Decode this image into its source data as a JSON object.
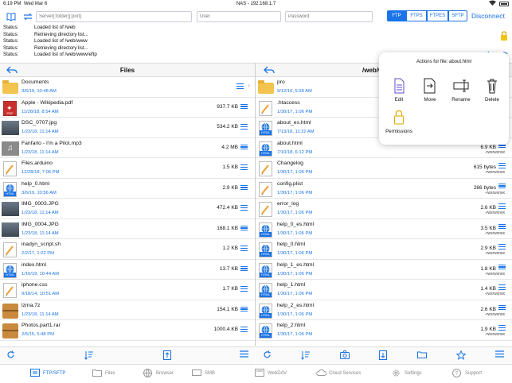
{
  "statusbar": {
    "time": "6:19 PM",
    "date": "Wed Mar 6",
    "title": "NAS - 192.168.1.7"
  },
  "connection": {
    "server_placeholder": "Server[:folder][:port]",
    "user_placeholder": "User",
    "password_placeholder": "Password",
    "protocols": [
      "FTP",
      "FTPS",
      "FTPES",
      "SFTP"
    ],
    "active_protocol": "FTP",
    "disconnect_label": "Disconnect"
  },
  "log": [
    {
      "k": "Status:",
      "v": "Loaded list of /web"
    },
    {
      "k": "Status:",
      "v": "Retrieving directory list..."
    },
    {
      "k": "Status:",
      "v": "Loaded list of /web/www"
    },
    {
      "k": "Status:",
      "v": "Retrieving directory list..."
    },
    {
      "k": "Status:",
      "v": "Loaded list of /web/www/eftp"
    }
  ],
  "left_pane": {
    "title": "Files",
    "rows": [
      {
        "name": "Documents",
        "date": "3/6/19, 10:48 AM",
        "size": "",
        "type": "folder"
      },
      {
        "name": "Apple - Wikipedia.pdf",
        "date": "11/28/18, 8:54 AM",
        "size": "937.7 KB",
        "type": "pdf"
      },
      {
        "name": "DSC_0707.jpg",
        "date": "1/23/18, 11:14 AM",
        "size": "534.2 KB",
        "type": "photo"
      },
      {
        "name": "Fanfarlo - I'm a Pilot.mp3",
        "date": "1/23/18, 11:14 AM",
        "size": "4.2 MB",
        "type": "audio"
      },
      {
        "name": "Files.arduino",
        "date": "12/28/18, 7:06 PM",
        "size": "1.5 KB",
        "type": "text"
      },
      {
        "name": "help_0.html",
        "date": "3/6/19, 10:56 AM",
        "size": "2.9 KB",
        "type": "html"
      },
      {
        "name": "IMG_0003.JPG",
        "date": "1/23/18, 11:14 AM",
        "size": "472.4 KB",
        "type": "photo"
      },
      {
        "name": "IMG_0004.JPG",
        "date": "1/23/18, 11:14 AM",
        "size": "168.1 KB",
        "type": "photo"
      },
      {
        "name": "inadyn_script.sh",
        "date": "2/2/17, 1:22 PM",
        "size": "1.2 KB",
        "type": "text"
      },
      {
        "name": "index.html",
        "date": "1/10/19, 10:44 AM",
        "size": "13.7 KB",
        "type": "html"
      },
      {
        "name": "iphone.css",
        "date": "9/18/14, 10:51 AM",
        "size": "1.7 KB",
        "type": "text"
      },
      {
        "name": "lzma.7z",
        "date": "1/23/18, 11:14 AM",
        "size": "154.1 KB",
        "type": "archive"
      },
      {
        "name": "Photos.part1.rar",
        "date": "2/5/15, 5:48 PM",
        "size": "1000.4 KB",
        "type": "archive"
      }
    ]
  },
  "right_pane": {
    "title": "/web/w",
    "rows": [
      {
        "name": "pro",
        "date": "9/12/16, 5:58 AM",
        "size": "",
        "perm": "",
        "type": "folder"
      },
      {
        "name": ".htaccess",
        "date": "1/30/17, 1:06 PM",
        "size": "",
        "perm": "",
        "type": "text"
      },
      {
        "name": "about_es.html",
        "date": "7/13/18, 11:22 AM",
        "size": "",
        "perm": "",
        "type": "html"
      },
      {
        "name": "about.html",
        "date": "7/10/18, 6:12 PM",
        "size": "6.9 KB",
        "perm": "-rwxrwxrwx",
        "type": "html"
      },
      {
        "name": "Changelog",
        "date": "1/30/17, 1:06 PM",
        "size": "615 bytes",
        "perm": "-rwxrwxrwx",
        "type": "text"
      },
      {
        "name": "config.plist",
        "date": "1/30/17, 1:06 PM",
        "size": "266 bytes",
        "perm": "-rwxrwxrwx",
        "type": "text"
      },
      {
        "name": "error_log",
        "date": "1/30/17, 1:06 PM",
        "size": "2.6 KB",
        "perm": "-rwxrwxrwx",
        "type": "text"
      },
      {
        "name": "help_0_es.html",
        "date": "1/30/17, 1:06 PM",
        "size": "3.5 KB",
        "perm": "-rwxrwxrwx",
        "type": "html"
      },
      {
        "name": "help_0.html",
        "date": "1/30/17, 1:06 PM",
        "size": "2.9 KB",
        "perm": "-rwxrwxrwx",
        "type": "html"
      },
      {
        "name": "help_1_es.html",
        "date": "1/30/17, 1:06 PM",
        "size": "1.8 KB",
        "perm": "-rwxrwxrwx",
        "type": "html"
      },
      {
        "name": "help_1.html",
        "date": "1/30/17, 1:06 PM",
        "size": "1.4 KB",
        "perm": "-rwxrwxrwx",
        "type": "html"
      },
      {
        "name": "help_2_es.html",
        "date": "1/30/17, 1:06 PM",
        "size": "2.6 KB",
        "perm": "-rwxrwxrwx",
        "type": "html"
      },
      {
        "name": "help_2.html",
        "date": "1/30/17, 1:06 PM",
        "size": "1.9 KB",
        "perm": "-rwxrwxrwx",
        "type": "html"
      }
    ]
  },
  "popover": {
    "title": "Actions for file: about.html",
    "actions": [
      "Edit",
      "Move",
      "Rename",
      "Delete",
      "Permissions"
    ]
  },
  "tabs": [
    "FTP/SFTP",
    "Files",
    "Browser",
    "SMB",
    "WebDAV",
    "Cloud Services",
    "Settings",
    "Support"
  ],
  "active_tab": "FTP/SFTP",
  "colors": {
    "accent": "#1a73e8",
    "folder": "#f2c34e"
  }
}
